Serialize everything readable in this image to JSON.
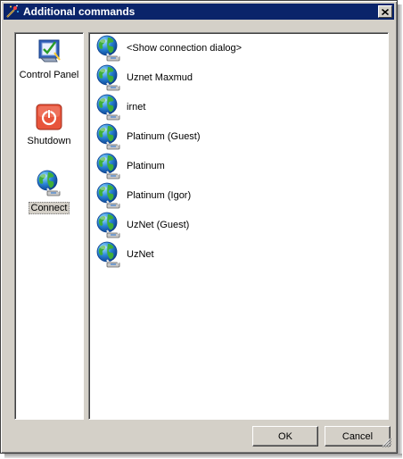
{
  "window": {
    "title": "Additional commands"
  },
  "sidebar": {
    "items": [
      {
        "label": "Control Panel",
        "icon": "control-panel-icon"
      },
      {
        "label": "Shutdown",
        "icon": "power-icon"
      },
      {
        "label": "Connect",
        "icon": "globe-network-icon",
        "selected": true
      }
    ]
  },
  "connections": [
    {
      "label": "<Show connection dialog>"
    },
    {
      "label": "Uznet Maxmud"
    },
    {
      "label": "irnet"
    },
    {
      "label": "Platinum (Guest)"
    },
    {
      "label": "Platinum"
    },
    {
      "label": "Platinum (Igor)"
    },
    {
      "label": "UzNet (Guest)"
    },
    {
      "label": "UzNet"
    }
  ],
  "buttons": {
    "ok": "OK",
    "cancel": "Cancel"
  }
}
